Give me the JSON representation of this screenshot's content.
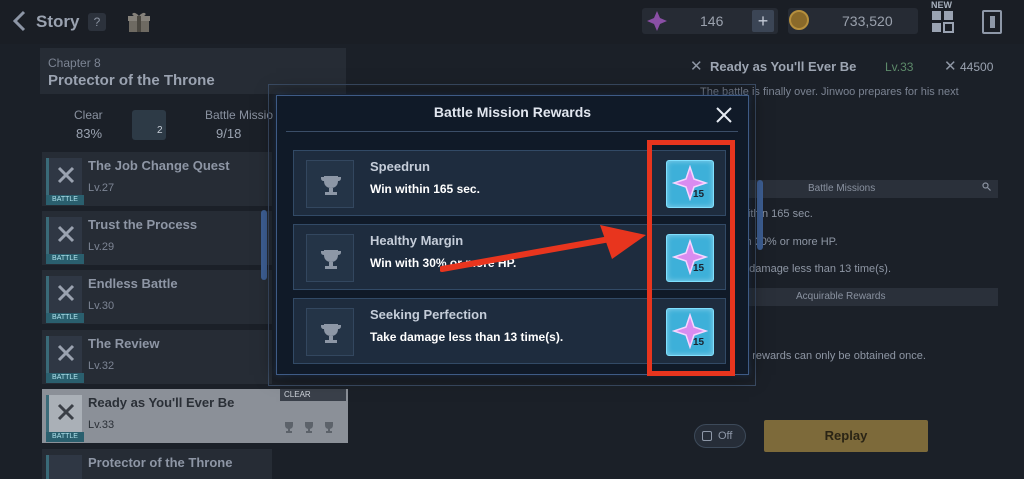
{
  "topbar": {
    "title": "Story",
    "help": "?",
    "gem_count": "146",
    "plus": "+",
    "gold_count": "733,520",
    "new_badge": "NEW"
  },
  "chapter": {
    "label": "Chapter 8",
    "title": "Protector of the Throne",
    "clear_label": "Clear",
    "clear_value": "83%",
    "thumb_count": "2",
    "battle_missions_label": "Battle Missio",
    "battle_missions_value": "9/18"
  },
  "quests": [
    {
      "name": "The Job Change Quest",
      "level": "Lv.27",
      "tag": "BATTLE"
    },
    {
      "name": "Trust the Process",
      "level": "Lv.29",
      "tag": "BATTLE"
    },
    {
      "name": "Endless Battle",
      "level": "Lv.30",
      "tag": "BATTLE"
    },
    {
      "name": "The Review",
      "level": "Lv.32",
      "tag": "BATTLE"
    },
    {
      "name": "Ready as You'll Ever Be",
      "level": "Lv.33",
      "tag": "BATTLE",
      "status": "CLEAR"
    },
    {
      "name": "Protector of the Throne",
      "level": "",
      "tag": ""
    }
  ],
  "right_panel": {
    "name": "Ready as You'll Ever Be",
    "level": "Lv.33",
    "power": "44500",
    "description": "The battle is finally over. Jinwoo prepares for his next",
    "battle_missions_header": "Battle Missions",
    "mission_lines": [
      "within 165 sec.",
      "ith 30% or more HP.",
      "e damage less than 13 time(s)."
    ],
    "acquirable_header": "Acquirable Rewards",
    "note": "ry rewards can only be obtained once.",
    "toggle_label": "Off",
    "replay_label": "Replay"
  },
  "modal": {
    "title": "Battle Mission Rewards",
    "missions": [
      {
        "name": "Speedrun",
        "description": "Win within 165 sec.",
        "reward_qty": "15"
      },
      {
        "name": "Healthy Margin",
        "description": "Win with 30% or more HP.",
        "reward_qty": "15"
      },
      {
        "name": "Seeking Perfection",
        "description": "Take damage less than 13 time(s).",
        "reward_qty": "15"
      }
    ]
  },
  "colors": {
    "accent_highlight": "#e8351e",
    "reward_tile": "#3db0d9",
    "gem": "#d98cf0"
  }
}
